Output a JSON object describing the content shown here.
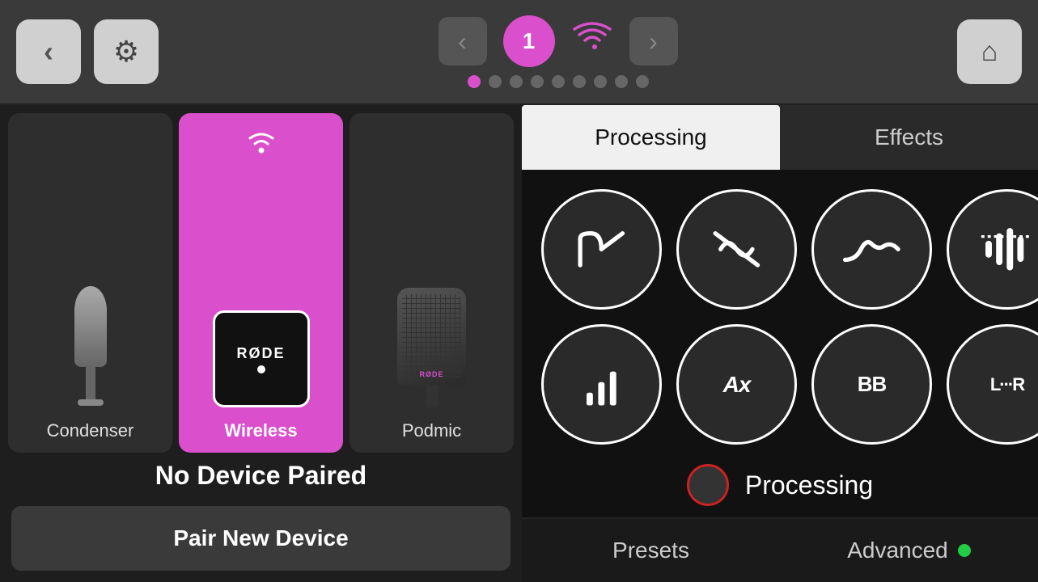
{
  "topbar": {
    "back_label": "‹",
    "settings_icon": "⚙",
    "home_icon": "⌂",
    "device_number": "1",
    "nav_prev": "‹",
    "nav_next": "›",
    "dots": [
      true,
      false,
      false,
      false,
      false,
      false,
      false,
      false,
      false
    ]
  },
  "devices": [
    {
      "id": "condenser",
      "label": "Condenser",
      "active": false
    },
    {
      "id": "wireless",
      "label": "Wireless",
      "active": true
    },
    {
      "id": "podmic",
      "label": "Podmic",
      "active": false
    }
  ],
  "no_device_text": "No Device Paired",
  "pair_button_label": "Pair New Device",
  "tabs": [
    {
      "id": "processing",
      "label": "Processing",
      "active": true
    },
    {
      "id": "effects",
      "label": "Effects",
      "active": false
    }
  ],
  "processing_buttons": [
    {
      "id": "hp-filter",
      "type": "svg_hpf"
    },
    {
      "id": "de-ess",
      "type": "svg_dess"
    },
    {
      "id": "eq",
      "type": "svg_eq"
    },
    {
      "id": "comp-limit",
      "type": "svg_compressor"
    },
    {
      "id": "gain",
      "type": "svg_gain"
    },
    {
      "id": "auto-gain",
      "type": "text_Ax"
    },
    {
      "id": "bright-boost",
      "type": "text_BB"
    },
    {
      "id": "stereo-pan",
      "type": "text_LR"
    }
  ],
  "status": {
    "label": "Processing"
  },
  "bottom_bar": {
    "presets_label": "Presets",
    "advanced_label": "Advanced"
  }
}
